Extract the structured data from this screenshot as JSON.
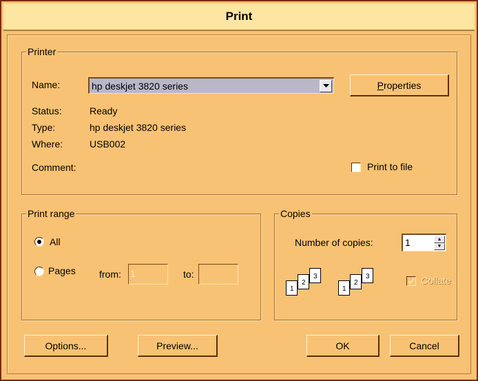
{
  "window": {
    "title": "Print"
  },
  "printer": {
    "group_label": "Printer",
    "name_label": "Name:",
    "name_value": "hp deskjet 3820 series",
    "properties_button": "Properties",
    "properties_mnemonic": "P",
    "properties_rest": "roperties",
    "status_label": "Status:",
    "status_value": "Ready",
    "type_label": "Type:",
    "type_value": "hp deskjet 3820 series",
    "where_label": "Where:",
    "where_value": "USB002",
    "comment_label": "Comment:",
    "comment_value": "",
    "print_to_file_label": "Print to file",
    "print_to_file_checked": false
  },
  "print_range": {
    "group_label": "Print range",
    "all_label": "All",
    "all_selected": true,
    "pages_label": "Pages",
    "pages_selected": false,
    "from_label": "from:",
    "from_value": "1",
    "to_label": "to:",
    "to_value": ""
  },
  "copies": {
    "group_label": "Copies",
    "number_label": "Number of copies:",
    "number_value": "1",
    "collate_label": "Collate",
    "collate_checked": true,
    "collate_enabled": false,
    "page_numbers": [
      "1",
      "2",
      "3"
    ]
  },
  "buttons": {
    "options": "Options...",
    "preview": "Preview...",
    "ok": "OK",
    "cancel": "Cancel"
  },
  "icons": {
    "dropdown": "chevron-down-icon",
    "spin_up": "spin-up-icon",
    "spin_down": "spin-down-icon",
    "collate": "collate-pages-icon"
  },
  "colors": {
    "window_bg": "#f8c274",
    "title_bg": "#fde5a2",
    "frame": "#7e2a0c",
    "select_bg": "#b8b8c8"
  }
}
